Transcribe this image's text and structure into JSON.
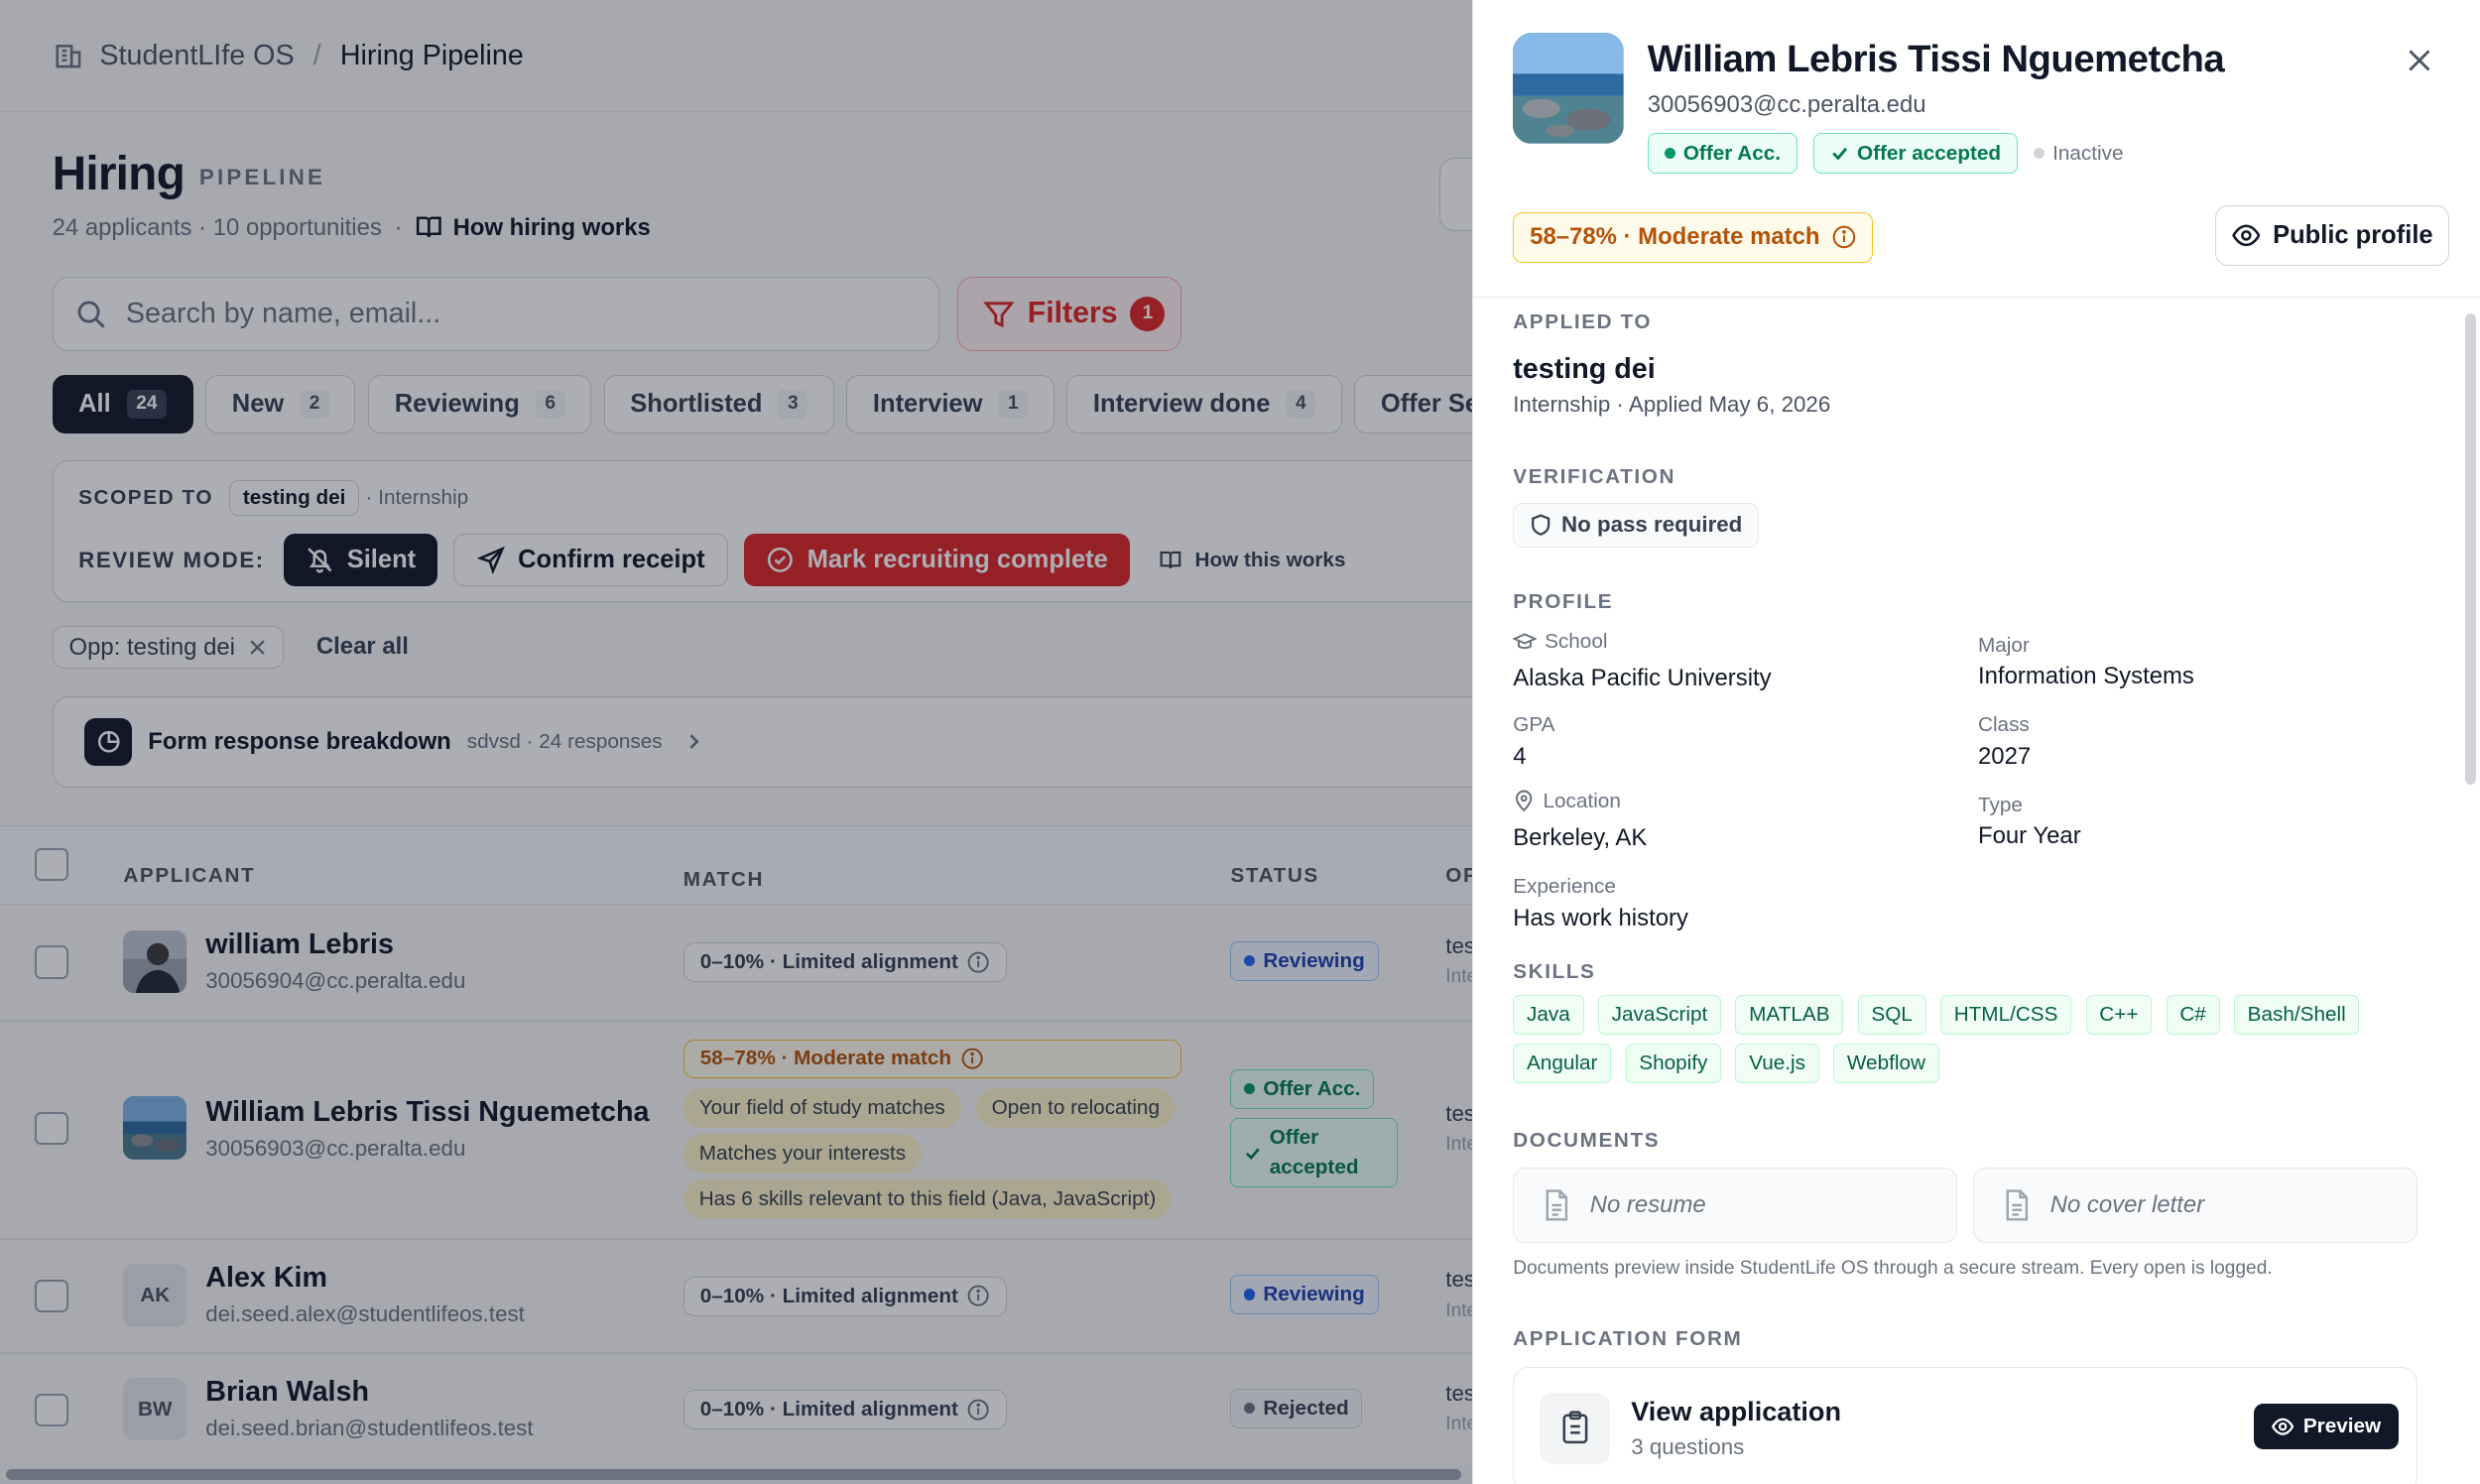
{
  "breadcrumb": {
    "app": "StudentLIfe OS",
    "separator": "/",
    "current": "Hiring Pipeline"
  },
  "page": {
    "title": "Hiring",
    "subtitle": "PIPELINE",
    "meta": "24 applicants · 10 opportunities",
    "meta_dot": "·",
    "how_link": "How hiring works"
  },
  "search": {
    "placeholder": "Search by name, email..."
  },
  "filters": {
    "label": "Filters",
    "count": "1"
  },
  "tabs": [
    {
      "label": "All",
      "count": "24"
    },
    {
      "label": "New",
      "count": "2"
    },
    {
      "label": "Reviewing",
      "count": "6"
    },
    {
      "label": "Shortlisted",
      "count": "3"
    },
    {
      "label": "Interview",
      "count": "1"
    },
    {
      "label": "Interview done",
      "count": "4"
    },
    {
      "label": "Offer Sent",
      "count": ""
    }
  ],
  "scope": {
    "label": "SCOPED TO",
    "chip": "testing dei",
    "type": "· Internship",
    "mode_label": "REVIEW MODE:",
    "silent": "Silent",
    "confirm": "Confirm receipt",
    "complete": "Mark recruiting complete",
    "how": "How this works"
  },
  "active_filter": {
    "label": "Opp: testing dei",
    "clear": "Clear all"
  },
  "form_breakdown": {
    "title": "Form response breakdown",
    "sub": "sdvsd · 24 responses"
  },
  "table": {
    "headers": {
      "applicant": "APPLICANT",
      "match": "MATCH",
      "status": "STATUS",
      "opportunity": "OP"
    },
    "rows": [
      {
        "name": "william Lebris",
        "email": "30056904@cc.peralta.edu",
        "match": "0–10% · Limited alignment",
        "status": "Reviewing",
        "opp": "tes",
        "opp_sub": "Inte"
      },
      {
        "name": "William Lebris Tissi Nguemetcha",
        "email": "30056903@cc.peralta.edu",
        "match": "58–78% · Moderate match",
        "reasons": [
          "Your field of study matches",
          "Open to relocating",
          "Matches your interests",
          "Has 6 skills relevant to this field (Java, JavaScript)"
        ],
        "status": "Offer Acc.",
        "status2": "Offer accepted",
        "opp": "tes",
        "opp_sub": "Inte"
      },
      {
        "name": "Alex Kim",
        "initials": "AK",
        "email": "dei.seed.alex@studentlifeos.test",
        "match": "0–10% · Limited alignment",
        "status": "Reviewing",
        "opp": "tes",
        "opp_sub": "Inte"
      },
      {
        "name": "Brian Walsh",
        "initials": "BW",
        "email": "dei.seed.brian@studentlifeos.test",
        "match": "0–10% · Limited alignment",
        "status": "Rejected",
        "opp": "tes",
        "opp_sub": "Inte"
      }
    ]
  },
  "panel": {
    "name": "William Lebris Tissi Nguemetcha",
    "email": "30056903@cc.peralta.edu",
    "badge1": "Offer Acc.",
    "badge2": "Offer accepted",
    "inactive": "Inactive",
    "match": "58–78% · Moderate match",
    "public_profile": "Public profile",
    "applied_label": "APPLIED TO",
    "applied_title": "testing dei",
    "applied_sub": "Internship · Applied May 6, 2026",
    "verification_label": "VERIFICATION",
    "verification": "No pass required",
    "profile_label": "PROFILE",
    "profile": {
      "school_label": "School",
      "school": "Alaska Pacific University",
      "major_label": "Major",
      "major": "Information Systems",
      "gpa_label": "GPA",
      "gpa": "4",
      "class_label": "Class",
      "class": "2027",
      "location_label": "Location",
      "location": "Berkeley, AK",
      "type_label": "Type",
      "type": "Four Year",
      "experience_label": "Experience",
      "experience": "Has work history"
    },
    "skills_label": "SKILLS",
    "skills": [
      "Java",
      "JavaScript",
      "MATLAB",
      "SQL",
      "HTML/CSS",
      "C++",
      "C#",
      "Bash/Shell",
      "Angular",
      "Shopify",
      "Vue.js",
      "Webflow"
    ],
    "documents_label": "DOCUMENTS",
    "no_resume": "No resume",
    "no_cover": "No cover letter",
    "documents_note": "Documents preview inside StudentLife OS through a secure stream. Every open is logged.",
    "appform_label": "APPLICATION FORM",
    "app_title": "View application",
    "app_sub": "3 questions",
    "preview": "Preview"
  },
  "colors": {
    "accent_red": "#dc2626",
    "dark": "#111827",
    "green": "#047857",
    "amber": "#b45309",
    "blue": "#1e40af"
  }
}
